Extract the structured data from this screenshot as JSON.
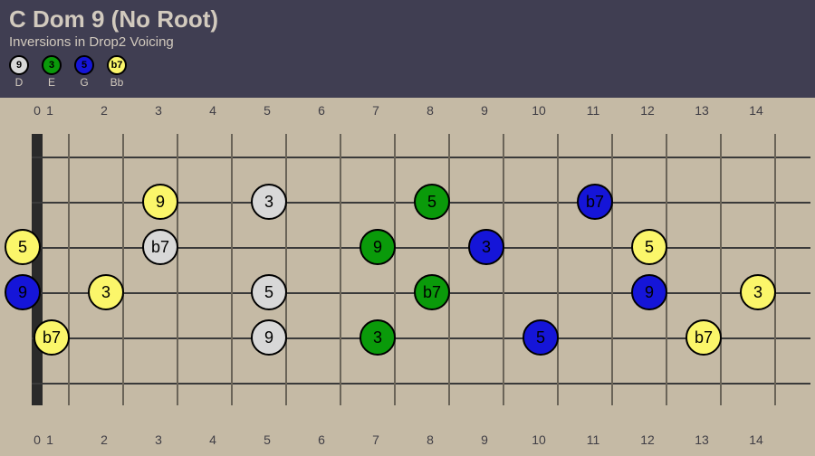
{
  "header": {
    "title": "C Dom 9 (No Root)",
    "subtitle": "Inversions in Drop2 Voicing"
  },
  "legend": [
    {
      "interval": "9",
      "note": "D",
      "color": "white"
    },
    {
      "interval": "3",
      "note": "E",
      "color": "green"
    },
    {
      "interval": "5",
      "note": "G",
      "color": "blue"
    },
    {
      "interval": "b7",
      "note": "Bb",
      "color": "yellow"
    }
  ],
  "fretboard": {
    "frets": 14,
    "strings": 6,
    "fret_labels": [
      "0",
      "1",
      "2",
      "3",
      "4",
      "5",
      "6",
      "7",
      "8",
      "9",
      "10",
      "11",
      "12",
      "13",
      "14"
    ]
  },
  "notes": [
    {
      "string": 3,
      "fret": 0,
      "label": "5",
      "color": "yellow"
    },
    {
      "string": 4,
      "fret": 0,
      "label": "9",
      "color": "blue"
    },
    {
      "string": 5,
      "fret": 1,
      "label": "b7",
      "color": "yellow"
    },
    {
      "string": 4,
      "fret": 2,
      "label": "3",
      "color": "yellow"
    },
    {
      "string": 2,
      "fret": 3,
      "label": "9",
      "color": "yellow"
    },
    {
      "string": 3,
      "fret": 3,
      "label": "b7",
      "color": "white"
    },
    {
      "string": 2,
      "fret": 5,
      "label": "3",
      "color": "white"
    },
    {
      "string": 4,
      "fret": 5,
      "label": "5",
      "color": "white"
    },
    {
      "string": 5,
      "fret": 5,
      "label": "9",
      "color": "white"
    },
    {
      "string": 3,
      "fret": 7,
      "label": "9",
      "color": "green"
    },
    {
      "string": 5,
      "fret": 7,
      "label": "3",
      "color": "green"
    },
    {
      "string": 2,
      "fret": 8,
      "label": "5",
      "color": "green"
    },
    {
      "string": 4,
      "fret": 8,
      "label": "b7",
      "color": "green"
    },
    {
      "string": 3,
      "fret": 9,
      "label": "3",
      "color": "blue"
    },
    {
      "string": 5,
      "fret": 10,
      "label": "5",
      "color": "blue"
    },
    {
      "string": 2,
      "fret": 11,
      "label": "b7",
      "color": "blue"
    },
    {
      "string": 3,
      "fret": 12,
      "label": "5",
      "color": "yellow"
    },
    {
      "string": 4,
      "fret": 12,
      "label": "9",
      "color": "blue"
    },
    {
      "string": 5,
      "fret": 13,
      "label": "b7",
      "color": "yellow"
    },
    {
      "string": 4,
      "fret": 14,
      "label": "3",
      "color": "yellow"
    }
  ]
}
